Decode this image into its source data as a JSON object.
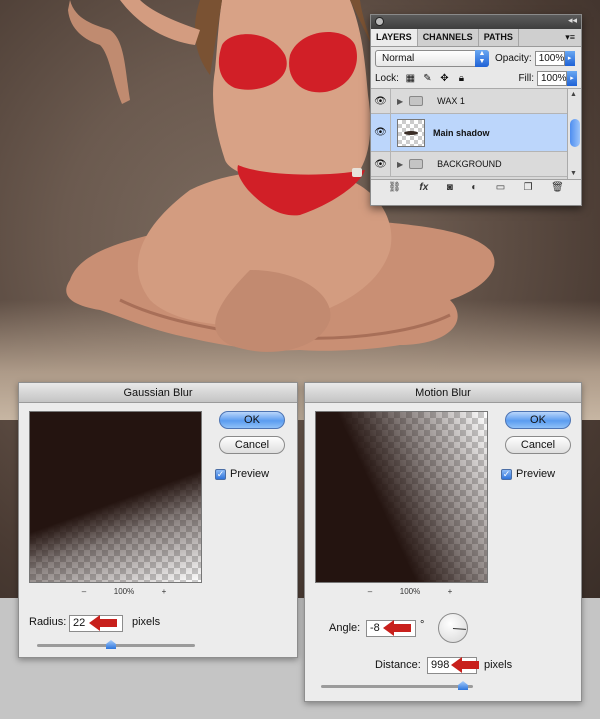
{
  "layers_panel": {
    "tabs": [
      "LAYERS",
      "CHANNELS",
      "PATHS"
    ],
    "blend_mode": "Normal",
    "opacity_label": "Opacity:",
    "opacity_value": "100%",
    "lock_label": "Lock:",
    "fill_label": "Fill:",
    "fill_value": "100%",
    "layers": [
      {
        "name": "WAX 1",
        "type": "group",
        "selected": false
      },
      {
        "name": "Main shadow",
        "type": "layer",
        "selected": true
      },
      {
        "name": "BACKGROUND",
        "type": "group",
        "selected": false
      }
    ],
    "footer_icons": [
      "link-icon",
      "fx-icon",
      "mask-icon",
      "adjustment-icon",
      "folder-icon",
      "new-layer-icon",
      "trash-icon"
    ],
    "footer_fx": "fx"
  },
  "gaussian_blur": {
    "title": "Gaussian Blur",
    "ok_label": "OK",
    "cancel_label": "Cancel",
    "preview_label": "Preview",
    "preview_checked": true,
    "zoom_out": "–",
    "zoom_level": "100%",
    "zoom_in": "+",
    "radius_label": "Radius:",
    "radius_value": "22",
    "radius_unit": "pixels"
  },
  "motion_blur": {
    "title": "Motion Blur",
    "ok_label": "OK",
    "cancel_label": "Cancel",
    "preview_label": "Preview",
    "preview_checked": true,
    "zoom_out": "–",
    "zoom_level": "100%",
    "zoom_in": "+",
    "angle_label": "Angle:",
    "angle_value": "-8",
    "angle_unit": "°",
    "distance_label": "Distance:",
    "distance_value": "998",
    "distance_unit": "pixels"
  },
  "colors": {
    "highlight_arrow": "#c8201c",
    "selection": "#bcd6fb",
    "accent": "#2f74dc"
  }
}
